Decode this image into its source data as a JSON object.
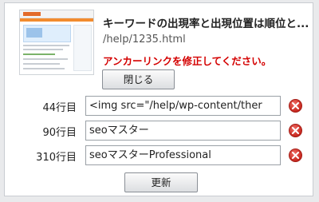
{
  "dialog": {
    "title": "キーワードの出現率と出現位置は順位と...",
    "path": "/help/1235.html",
    "warning": "アンカーリンクを修正してください。",
    "close_label": "閉じる",
    "update_label": "更新"
  },
  "rows": [
    {
      "line": "44行目",
      "value": "<img src=\"/help/wp-content/ther"
    },
    {
      "line": "90行目",
      "value": "seoマスター"
    },
    {
      "line": "310行目",
      "value": "seoマスターProfessional"
    }
  ],
  "icons": {
    "delete": "delete-icon",
    "thumbnail": "page-thumbnail"
  },
  "colors": {
    "warning": "#d40000",
    "delete": "#c8281f"
  }
}
